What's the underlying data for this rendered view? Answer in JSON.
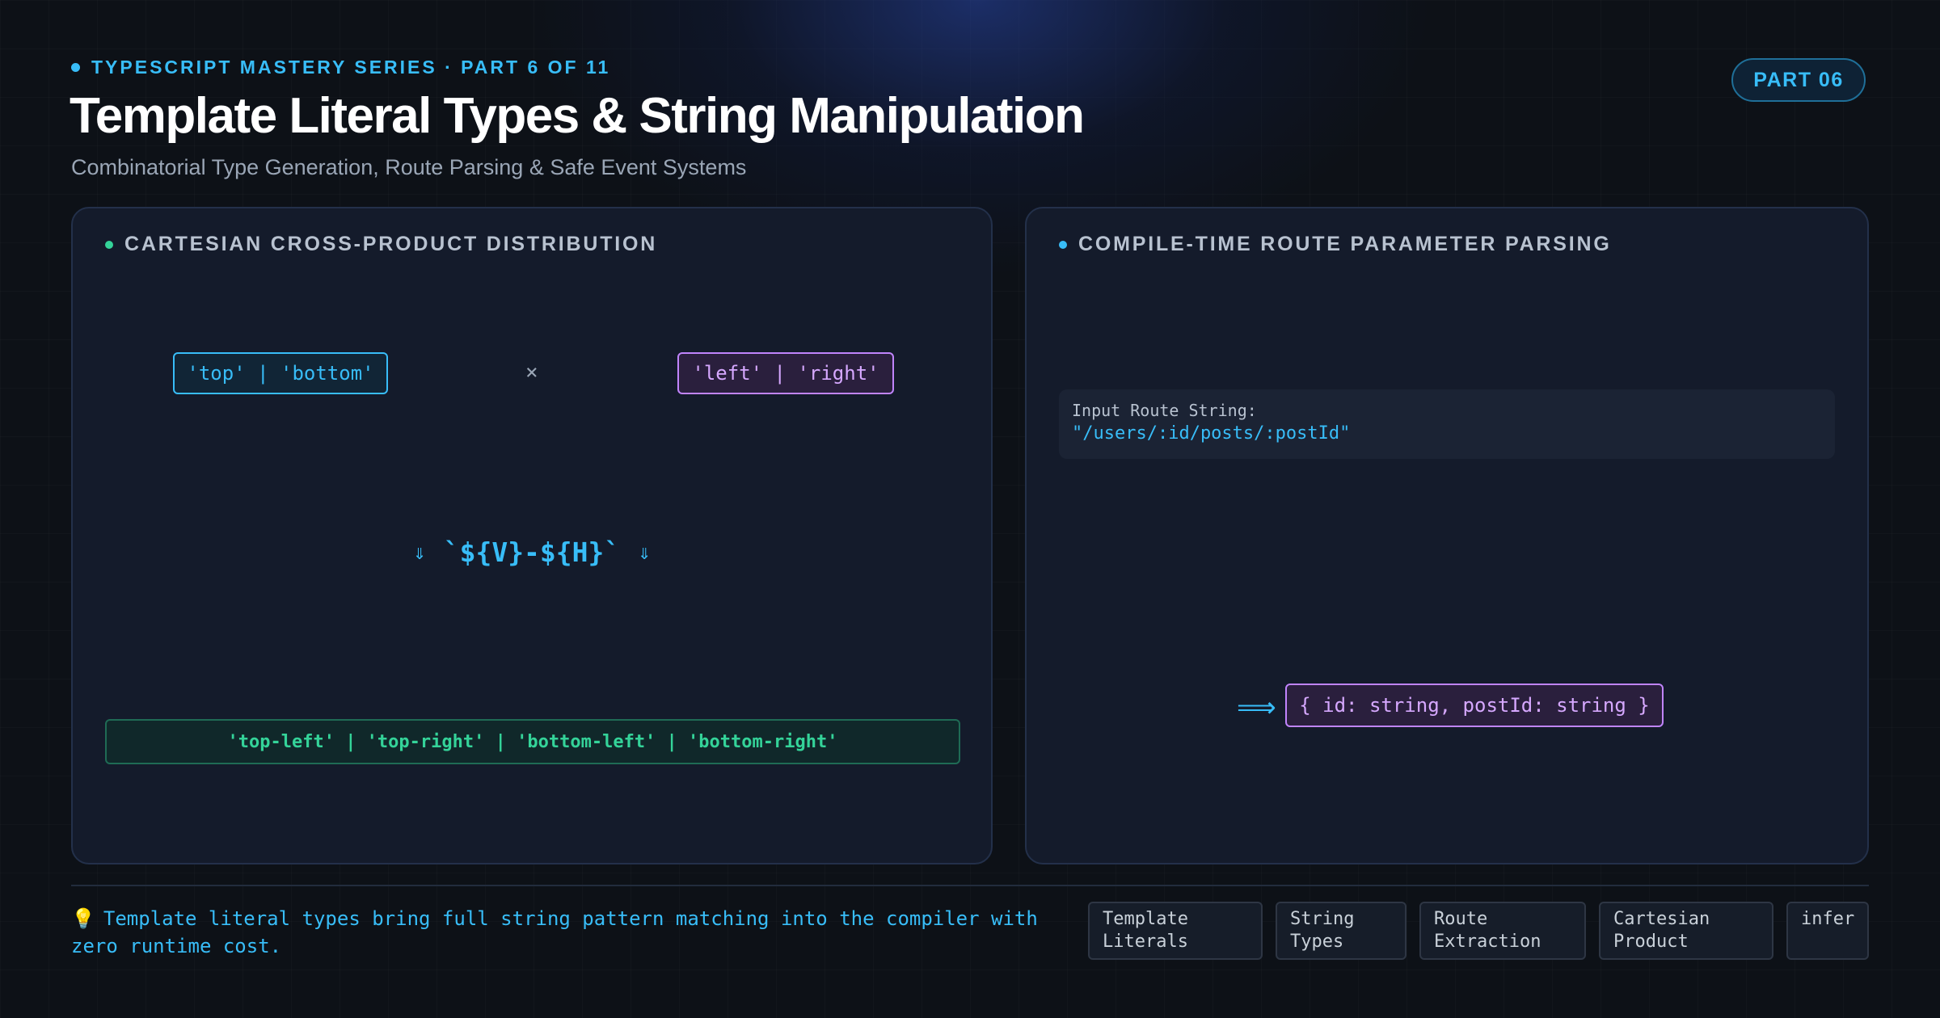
{
  "header": {
    "series": "TYPESCRIPT MASTERY SERIES · PART 6 OF 11",
    "title": "Template Literal Types & String Manipulation",
    "subtitle": "Combinatorial Type Generation, Route Parsing & Safe Event Systems",
    "part_badge": "PART 06"
  },
  "left_panel": {
    "title": "CARTESIAN CROSS-PRODUCT DISTRIBUTION",
    "vertical_union": "'top' | 'bottom'",
    "operator": "×",
    "horizontal_union": "'left' | 'right'",
    "arrow_left": "⇓",
    "template_expr": "`${V}-${H}`",
    "arrow_right": "⇓",
    "result_union": "'top-left' | 'top-right' | 'bottom-left' | 'bottom-right'"
  },
  "right_panel": {
    "title": "COMPILE-TIME ROUTE PARAMETER PARSING",
    "input_label": "Input Route String:",
    "input_value": "\"/users/:id/posts/:postId\"",
    "implies": "⟹",
    "result_type": "{ id: string, postId: string }"
  },
  "footer": {
    "tip_icon": "💡",
    "tip_text": "Template literal types bring full string pattern matching into the compiler with zero runtime cost.",
    "tags": [
      {
        "line1": "Template",
        "line2": "Literals"
      },
      {
        "line1": "String",
        "line2": "Types"
      },
      {
        "line1": "Route",
        "line2": "Extraction"
      },
      {
        "line1": "Cartesian",
        "line2": "Product"
      },
      {
        "line1": "infer",
        "line2": ""
      }
    ]
  },
  "colors": {
    "background": "#0d1117",
    "accent_blue": "#38bdf8",
    "accent_purple": "#c084fc",
    "accent_green": "#34d399",
    "panel": "#141b2b"
  }
}
